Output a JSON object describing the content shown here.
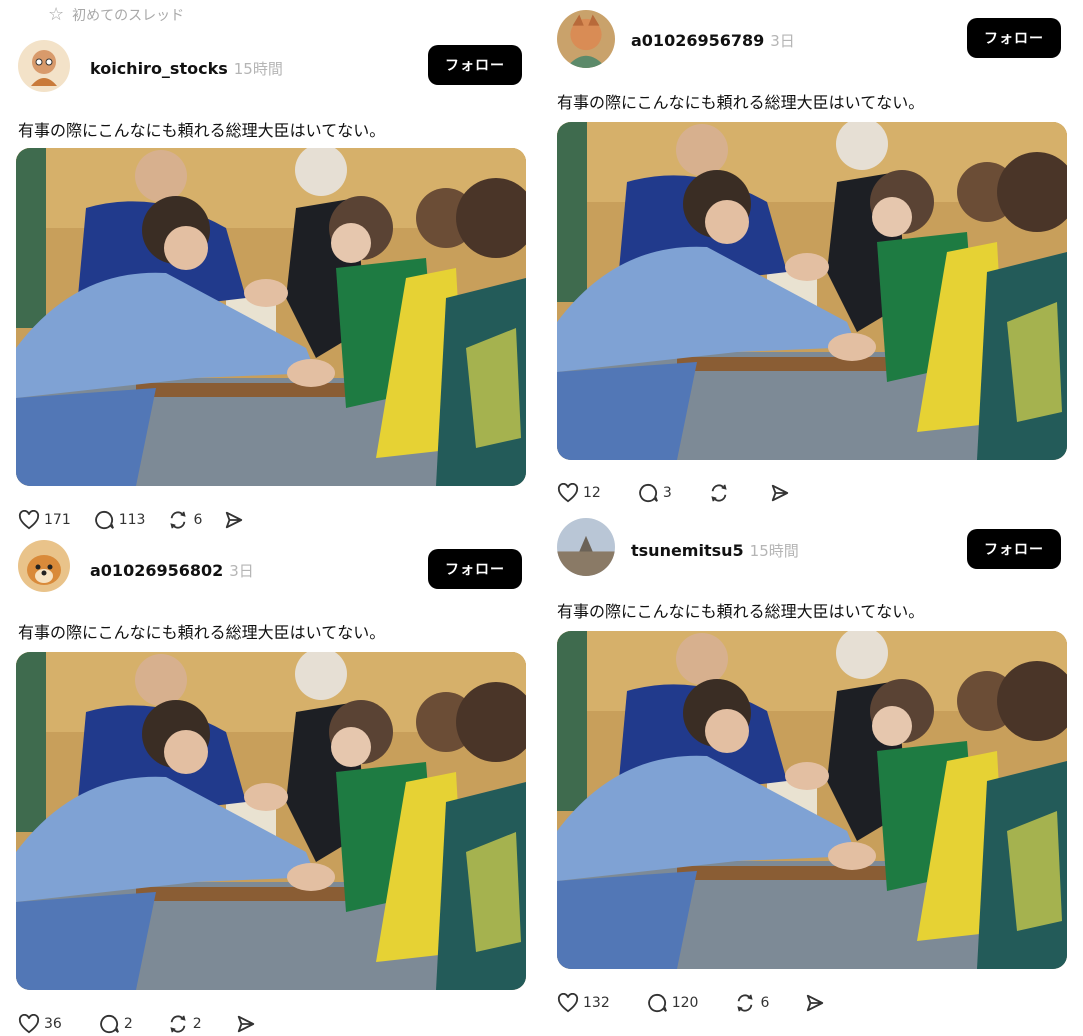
{
  "header": {
    "first_thread_label": "初めてのスレッド"
  },
  "posts": [
    {
      "username": "koichiro_stocks",
      "time": "15時間",
      "follow_label": "フォロー",
      "text": "有事の際にこんなにも頼れる総理大臣はいてない。",
      "likes": "171",
      "replies": "113",
      "reposts": "6"
    },
    {
      "username": "a01026956789",
      "time": "3日",
      "follow_label": "フォロー",
      "text": "有事の際にこんなにも頼れる総理大臣はいてない。",
      "likes": "12",
      "replies": "3",
      "reposts": ""
    },
    {
      "username": "a01026956802",
      "time": "3日",
      "follow_label": "フォロー",
      "text": "有事の際にこんなにも頼れる総理大臣はいてない。",
      "likes": "36",
      "replies": "2",
      "reposts": "2"
    },
    {
      "username": "tsunemitsu5",
      "time": "15時間",
      "follow_label": "フォロー",
      "text": "有事の際にこんなにも頼れる総理大臣はいてない。",
      "likes": "132",
      "replies": "120",
      "reposts": "6"
    }
  ],
  "icons": {
    "star": "star-icon",
    "like": "heart-icon",
    "reply": "comment-icon",
    "repost": "repost-icon",
    "share": "send-icon"
  },
  "colors": {
    "follow_button_bg": "#000000",
    "follow_button_text": "#ffffff",
    "muted_text": "#b5b5b5",
    "background": "#ffffff"
  }
}
